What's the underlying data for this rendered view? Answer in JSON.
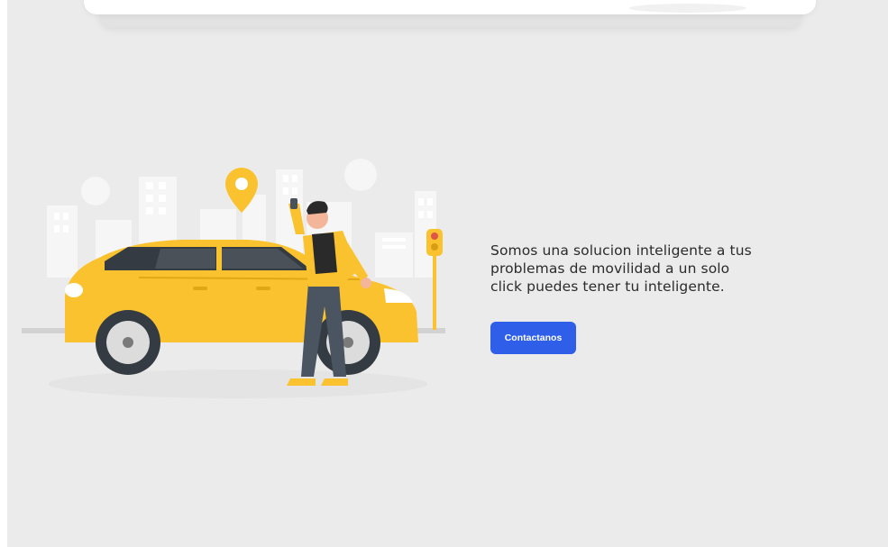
{
  "hero": {
    "description": "Somos una solucion inteligente a tus problemas de movilidad a un solo click puedes tener tu inteligente.",
    "contact_button_label": "Contactanos"
  },
  "colors": {
    "background": "#ebebeb",
    "accent": "#2f5ee8",
    "taxi_yellow": "#f9c22e",
    "text": "#2b2b2b"
  },
  "icons": [
    "location-pin-icon",
    "traffic-light-icon"
  ]
}
